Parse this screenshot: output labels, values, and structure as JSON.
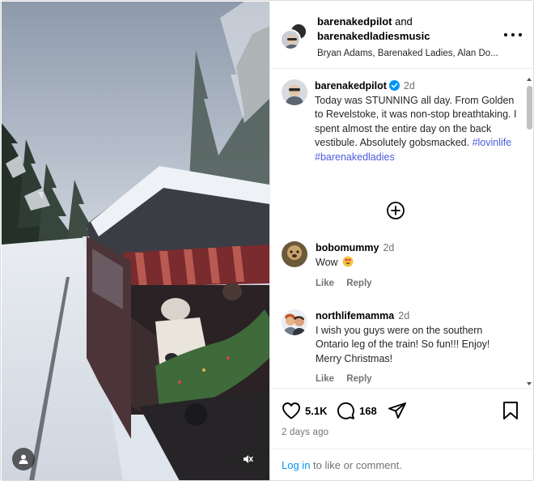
{
  "header": {
    "author_primary": "barenakedpilot",
    "joiner": "and",
    "author_secondary": "barenakedladiesmusic",
    "subtitle": "Bryan Adams, Barenaked Ladies, Alan Do..."
  },
  "caption": {
    "username": "barenakedpilot",
    "time": "2d",
    "text": "Today was STUNNING all day. From Golden to Revelstoke, it was non-stop breathtaking. I spent almost the entire day on the back vestibule. Absolutely gobsmacked.",
    "hashtags": [
      "#lovinlife",
      "#barenakedladies"
    ]
  },
  "comments": [
    {
      "username": "bobomummy",
      "time": "2d",
      "text": "Wow",
      "like_label": "Like",
      "reply_label": "Reply",
      "emoji": "heart-eyes"
    },
    {
      "username": "northlifemamma",
      "time": "2d",
      "text": "I wish you guys were on the southern Ontario leg of the train! So fun!!! Enjoy! Merry Christmas!",
      "like_label": "Like",
      "reply_label": "Reply"
    }
  ],
  "stats": {
    "likes": "5.1K",
    "comments": "168"
  },
  "date": "2 days ago",
  "login": {
    "link": "Log in",
    "rest": " to like or comment."
  },
  "icons": [
    "user-tag-icon",
    "mute-icon",
    "more-icon",
    "verified-icon",
    "load-more-icon",
    "heart-icon",
    "comment-icon",
    "share-icon",
    "bookmark-icon"
  ],
  "colors": {
    "link_blue": "#0095f6",
    "verified": "#0095f6",
    "hashtag": "#4a5bdc"
  }
}
